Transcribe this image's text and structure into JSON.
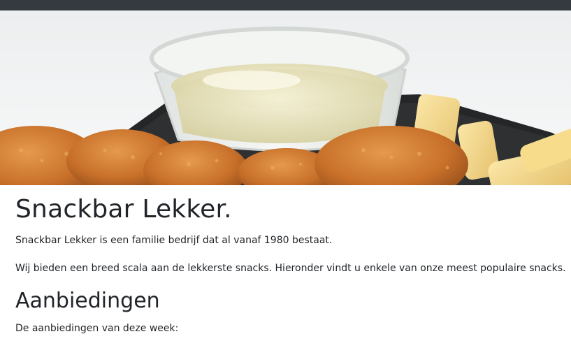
{
  "header": {},
  "hero": {
    "image_icon": "snack-image"
  },
  "main": {
    "title": "Snackbar Lekker.",
    "intro": "Snackbar Lekker is een familie bedrijf dat al vanaf 1980 bestaat.",
    "description": "Wij bieden een breed scala aan de lekkerste snacks. Hieronder vindt u enkele van onze meest populaire snacks.",
    "offers_title": "Aanbiedingen",
    "offers_subtitle": "De aanbiedingen van deze week:"
  },
  "colors": {
    "topbar": "#343a40",
    "text": "#212529"
  }
}
